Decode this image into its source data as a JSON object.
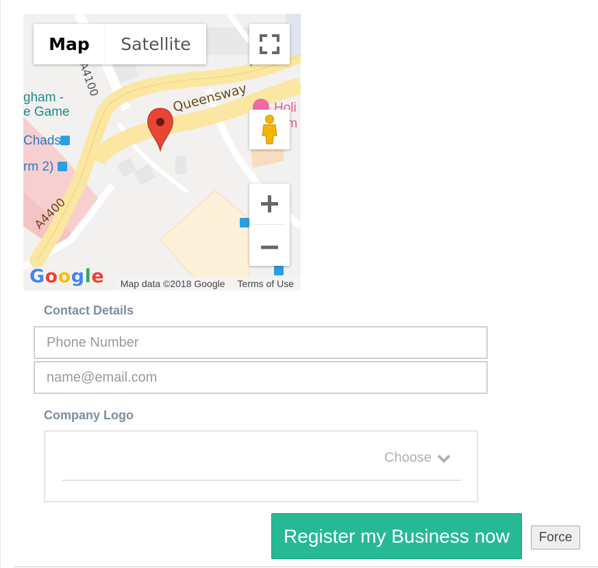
{
  "map": {
    "type_map": "Map",
    "type_satellite": "Satellite",
    "street_labels": [
      "Queensway",
      "A4400",
      "A4100",
      "A"
    ],
    "place_labels": [
      "gham -",
      "e Game",
      "Chads",
      "rm 2)",
      "Holi",
      "rm"
    ],
    "attribution": "Map data ©2018 Google",
    "terms": "Terms of Use",
    "logo_letters": [
      "G",
      "o",
      "o",
      "g",
      "l",
      "e"
    ],
    "icons": [
      "fullscreen-icon",
      "pegman-icon",
      "zoom-in-icon",
      "zoom-out-icon",
      "map-marker-icon"
    ]
  },
  "contact": {
    "label": "Contact Details",
    "phone_placeholder": "Phone Number",
    "email_placeholder": "name@email.com"
  },
  "logo": {
    "label": "Company Logo",
    "choose": "Choose"
  },
  "actions": {
    "register": "Register my Business now",
    "force": "Force"
  },
  "colors": {
    "accent": "#27b996",
    "label": "#7d8ca0"
  }
}
